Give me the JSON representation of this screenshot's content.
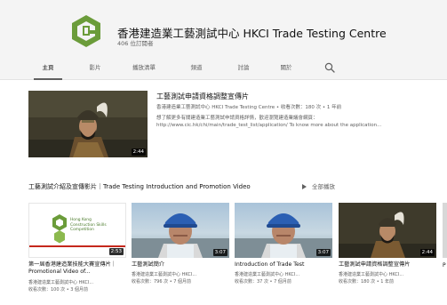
{
  "channel": {
    "name": "香港建造業工藝測試中心 HKCI Trade Testing Centre",
    "subscribers": "406 位訂閱者"
  },
  "tabs": [
    {
      "label": "主頁",
      "active": true
    },
    {
      "label": "影片",
      "active": false
    },
    {
      "label": "播放清單",
      "active": false
    },
    {
      "label": "頻道",
      "active": false
    },
    {
      "label": "討論",
      "active": false
    },
    {
      "label": "關於",
      "active": false
    }
  ],
  "featured": {
    "title": "工藝測試申請資格調整宣傳片",
    "meta": "香港建造業工藝測試中心 HKCI Trade Testing Centre • 收看次數：180 次 • 1 年前",
    "desc_line1": "想了解更多有關建造業工藝測試申請資格詳情，歡迎瀏覽建造業議會網頁：",
    "desc_line2": "http://www.cic.hk/chi/main/trade_test_list/application/ To know more about the application...",
    "duration": "2:44"
  },
  "shelf": {
    "title": "工藝測試介紹及宣傳影片｜Trade Testing Introduction and Promotion Video",
    "play_all": "全部播放",
    "videos": [
      {
        "title": "第一屆香港建造業技能大賽宣傳片｜Promotional Video of...",
        "channel": "香港建造業工藝測試中心 HKCI...",
        "meta": "收看次數：100 次 • 3 個月前",
        "duration": "2:53",
        "lines": 2
      },
      {
        "title": "工藝測試簡介",
        "channel": "香港建造業工藝測試中心 HKCI...",
        "meta": "收看次數：796 次 • 7 個月前",
        "duration": "3:07",
        "lines": 1
      },
      {
        "title": "Introduction of Trade Test",
        "channel": "香港建造業工藝測試中心 HKCI...",
        "meta": "收看次數：37 次 • 7 個月前",
        "duration": "3:07",
        "lines": 1
      },
      {
        "title": "工藝測試申請資格調整宣傳片",
        "channel": "香港建造業工藝測試中心 HKCI...",
        "meta": "收看次數：180 次 • 1 年前",
        "duration": "2:44",
        "lines": 1
      }
    ],
    "peek": {
      "title": "P"
    }
  },
  "promo_thumb": {
    "text_line1": "Hong Kong",
    "text_line2": "Construction Skills",
    "text_line3": "Competition"
  },
  "colors": {
    "header_bg": "#f4f4f4",
    "logo_green": "#6b9c3a",
    "duration_bg": "#000000",
    "promo_bar": "#c5281c"
  },
  "icons": {
    "search": "magnifier",
    "play_all": "play-triangle"
  }
}
